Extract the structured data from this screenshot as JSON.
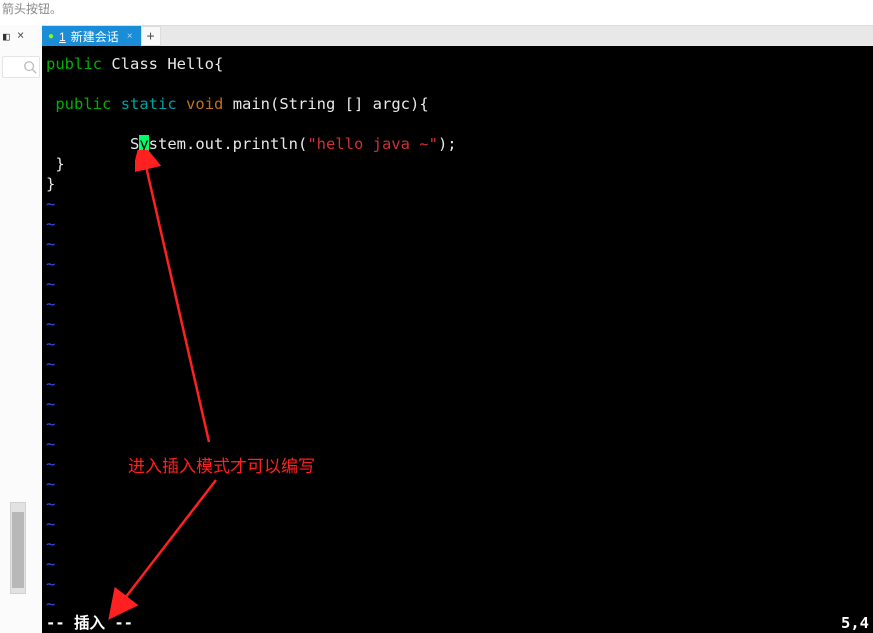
{
  "topHint": "箭头按钮。",
  "leftPanel": {
    "tabIcon": "◧",
    "close": "×"
  },
  "tabbar": {
    "active": {
      "dot": "●",
      "num": "1",
      "label": "新建会话",
      "close": "×"
    },
    "add": "+"
  },
  "code": {
    "line1_kw1": "public",
    "line1_rest": " Class Hello{",
    "blank": " ",
    "line2_indent": " ",
    "line2_kw1": "public",
    "line2_sp1": " ",
    "line2_kw2": "static",
    "line2_sp2": " ",
    "line2_kw3": "void",
    "line2_rest": " main(String [] argc){",
    "line3_indent": "         S",
    "line3_cursor": "y",
    "line3_after": "stem.out.println(",
    "line3_str": "\"hello java ~\"",
    "line3_end": ");",
    "line4": " }",
    "line5": "}",
    "tilde": "~"
  },
  "status": {
    "mode": "-- 插入 --",
    "pos": "5,4"
  },
  "annotation": "进入插入模式才可以编写"
}
